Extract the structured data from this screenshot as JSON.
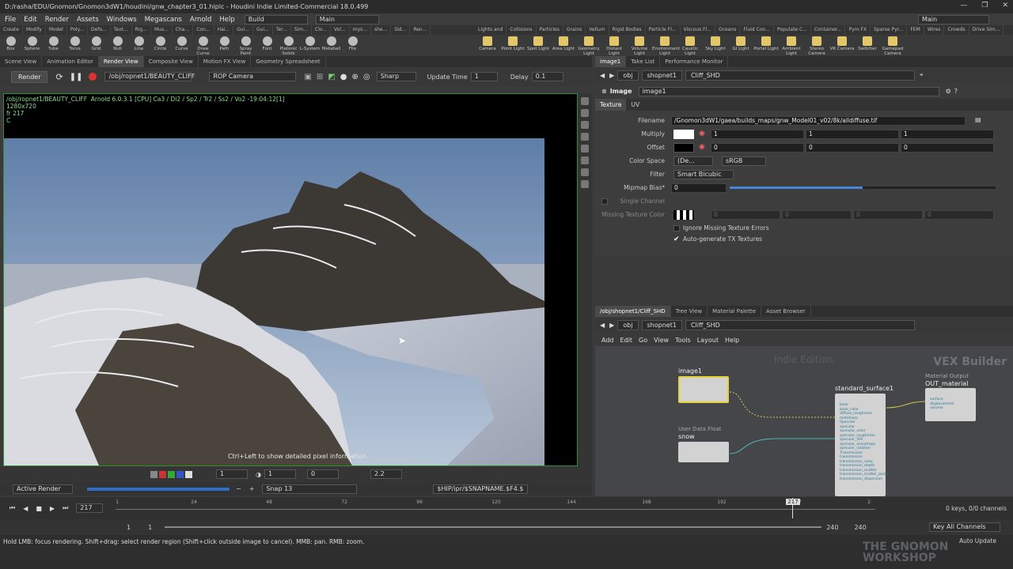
{
  "window": {
    "title": "D:/rasha/EDU/Gnomon/Gnomon3dW1/houdini/gnw_chapter3_01.hiplc - Houdini Indie Limited-Commercial 18.0.499",
    "controls": [
      "—",
      "❐",
      "✕"
    ]
  },
  "menu": {
    "items": [
      "File",
      "Edit",
      "Render",
      "Assets",
      "Windows",
      "Megascans",
      "Arnold",
      "Help"
    ],
    "desktop": "Build",
    "main": "Main",
    "right_desktop": "Main"
  },
  "shelf_tabs_left": [
    "Create",
    "Modify",
    "Model",
    "Poly...",
    "Defo...",
    "Text...",
    "Rig...",
    "Mus...",
    "Cha...",
    "Con...",
    "Hai...",
    "Gui...",
    "Gui...",
    "Ter...",
    "Sim...",
    "Clo...",
    "Vol...",
    "mys...",
    "she...",
    "Sid...",
    "Ren..."
  ],
  "shelf_tabs_right": [
    "Lights and",
    "Collisions",
    "Particles",
    "Grains",
    "Vellum",
    "Rigid Bodies",
    "Particle Fl...",
    "Viscous Fl...",
    "Oceans",
    "Fluid Con...",
    "Populate C...",
    "Container...",
    "Pyro FX",
    "Sparse Pyr...",
    "FEM",
    "Wires",
    "Crowds",
    "Drive Sim..."
  ],
  "tools_left": [
    "Box",
    "Sphere",
    "Tube",
    "Torus",
    "Grid",
    "Null",
    "Line",
    "Circle",
    "Curve",
    "Draw Curve",
    "Path",
    "Spray Paint",
    "Font",
    "Platonic Solids",
    "L-System",
    "Metaball",
    "File"
  ],
  "tools_right": [
    "Camera",
    "Point Light",
    "Spot Light",
    "Area Light",
    "Geometry Light",
    "Distant Light",
    "Volume Light",
    "Environment Light",
    "Caustic Light",
    "Sky Light",
    "GI Light",
    "Portal Light",
    "Ambient Light",
    "Stereo Camera",
    "VR Camera",
    "Switcher",
    "Gamepad Camera"
  ],
  "left_pane_tabs": [
    "Scene View",
    "Animation Editor",
    "Render View",
    "Composite View",
    "Motion FX View",
    "Geometry Spreadsheet"
  ],
  "render_toolbar": {
    "render_label": "Render",
    "rop_path": "/obj/ropnet1/BEAUTY_CLIFF",
    "camera": "ROP Camera",
    "quality": "Sharp",
    "update_time_label": "Update Time",
    "update_time": "1",
    "delay_label": "Delay",
    "delay": "0.1"
  },
  "render_info": "/obj/ropnet1/BEAUTY_CLIFF  Arnold 6.0.3.1 [CPU] Ca3 / Di2 / Sp2 / Tr2 / Ss2 / Vo2 -19:04:12[1]\n1280x720\nfr 217\nC",
  "render_hint": "Ctrl+Left to show detailed pixel information.",
  "render_bottom": {
    "frame": "1",
    "val2": "1",
    "val3": "0",
    "gamma": "2.2"
  },
  "render_status": {
    "active": "Active Render",
    "snap": "Snap 13",
    "output": "$HIP/ipr/$SNAPNAME.$F4.$"
  },
  "param_pane": {
    "tabs": [
      "image1",
      "Take List",
      "Performance Monitor"
    ],
    "path_obj": "obj",
    "path_net": "shopnet1",
    "path_node": "Cliff_SHD",
    "node_type": "Image",
    "node_name": "image1",
    "subtabs": [
      "Texture",
      "UV"
    ]
  },
  "params": {
    "filename_label": "Filename",
    "filename": "/Gnomon3dW1/gaea/builds_maps/gnw_Model01_v02/8k/alldiffuse.tif",
    "multiply_label": "Multiply",
    "multiply": [
      "1",
      "1",
      "1"
    ],
    "offset_label": "Offset",
    "offset": [
      "0",
      "0",
      "0"
    ],
    "colorspace_label": "Color Space",
    "colorspace": "(De...",
    "colorspace2": "sRGB",
    "filter_label": "Filter",
    "filter": "Smart Bicubic",
    "mipmap_label": "Mipmap Bias*",
    "mipmap": "0",
    "single_label": "Single Channel",
    "missing_label": "Missing Texture Color",
    "missing": [
      "0",
      "0",
      "0",
      "0"
    ],
    "ignore_label": "Ignore Missing Texture Errors",
    "autogen_label": "Auto-generate TX Textures"
  },
  "network_pane": {
    "tabs": [
      "/obj/shopnet1/Cliff_SHD",
      "Tree View",
      "Material Palette",
      "Asset Browser"
    ],
    "path_obj": "obj",
    "path_net": "shopnet1",
    "path_node": "Cliff_SHD",
    "menu": [
      "Add",
      "Edit",
      "Go",
      "View",
      "Tools",
      "Layout",
      "Help"
    ],
    "watermark": "Indie Edition",
    "context": "VEX Builder"
  },
  "nodes": {
    "image1": {
      "name": "image1"
    },
    "snow": {
      "name": "snow",
      "type": "User Data Float"
    },
    "surface": {
      "name": "standard_surface1",
      "params": [
        "base",
        "base_color",
        "diffuse_roughness",
        "metalness",
        "Specular",
        "specular",
        "specular_color",
        "specular_roughness",
        "specular_IOR",
        "specular_anisotropy",
        "specular_rotation",
        "Transmission",
        "transmission",
        "transmission_color",
        "transmission_depth",
        "transmission_scatter",
        "transmission_scatter_aniso...",
        "transmission_dispersion"
      ]
    },
    "out": {
      "name": "OUT_material",
      "type": "Material Output",
      "params": [
        "surface",
        "displacement",
        "volume"
      ]
    }
  },
  "timeline": {
    "frame": "217",
    "ticks": [
      "1",
      "24",
      "48",
      "72",
      "96",
      "120",
      "144",
      "168",
      "192",
      "217",
      "2"
    ],
    "start": "1",
    "start2": "1",
    "end": "240",
    "end2": "240",
    "keys": "0 keys, 0/0 channels",
    "key_all": "Key All Channels",
    "auto_update": "Auto Update"
  },
  "status": {
    "message": "Hold LMB: focus rendering. Shift+drag: select render region (Shift+click outside image to cancel). MMB: pan. RMB: zoom."
  },
  "brand": {
    "line1": "THE GNOMON",
    "line2": "WORKSHOP"
  }
}
